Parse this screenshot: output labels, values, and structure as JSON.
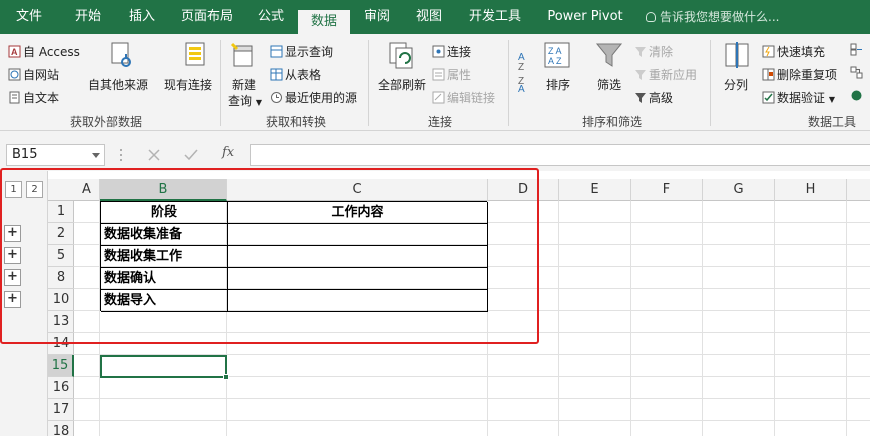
{
  "tabs": [
    {
      "label": "文件",
      "active": false
    },
    {
      "label": "开始",
      "active": false
    },
    {
      "label": "插入",
      "active": false
    },
    {
      "label": "页面布局",
      "active": false
    },
    {
      "label": "公式",
      "active": false
    },
    {
      "label": "数据",
      "active": true
    },
    {
      "label": "审阅",
      "active": false
    },
    {
      "label": "视图",
      "active": false
    },
    {
      "label": "开发工具",
      "active": false
    },
    {
      "label": "Power Pivot",
      "active": false
    }
  ],
  "tell_me": "告诉我您想要做什么...",
  "ribbon": {
    "get_external": {
      "access": "自 Access",
      "web": "自网站",
      "text": "自文本",
      "other_sources": "自其他来源",
      "existing": "现有连接",
      "label": "获取外部数据"
    },
    "get_transform": {
      "new_query_line1": "新建",
      "new_query_line2": "查询",
      "show_queries": "显示查询",
      "from_table": "从表格",
      "recent_sources": "最近使用的源",
      "label": "获取和转换"
    },
    "connections": {
      "refresh_all": "全部刷新",
      "connections": "连接",
      "properties": "属性",
      "edit_links": "编辑链接",
      "label": "连接"
    },
    "sort_filter": {
      "sort": "排序",
      "filter": "筛选",
      "clear": "清除",
      "reapply": "重新应用",
      "advanced": "高级",
      "label": "排序和筛选"
    },
    "data_tools": {
      "split": "分列",
      "flash_fill": "快速填充",
      "remove_dup": "删除重复项",
      "validation": "数据验证",
      "label": "数据工具"
    }
  },
  "formula_bar": {
    "name_box": "B15",
    "fx": "fx",
    "formula": ""
  },
  "outline": {
    "levels": [
      "1",
      "2"
    ],
    "expand_symbol": "+"
  },
  "columns": [
    "A",
    "B",
    "C",
    "D",
    "E",
    "F",
    "G",
    "H"
  ],
  "rows": [
    "1",
    "2",
    "5",
    "8",
    "10",
    "13",
    "14",
    "15",
    "16",
    "17",
    "18"
  ],
  "active_row": "15",
  "active_column": "B",
  "table": {
    "header": [
      "阶段",
      "工作内容"
    ],
    "body": [
      [
        "数据收集准备",
        ""
      ],
      [
        "数据收集工作",
        ""
      ],
      [
        "数据确认",
        ""
      ],
      [
        "数据导入",
        ""
      ]
    ]
  },
  "colors": {
    "accent": "#217346",
    "highlight": "#e02020"
  }
}
